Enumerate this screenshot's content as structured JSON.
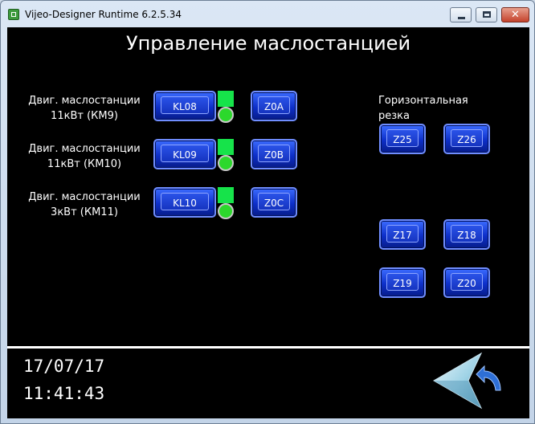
{
  "window": {
    "title": "Vijeo-Designer Runtime 6.2.5.34",
    "close_glyph": "✕"
  },
  "page": {
    "title": "Управление маслостанцией"
  },
  "motors": [
    {
      "label_line1": "Двиг. маслостанции",
      "label_line2": "11кВт (КМ9)",
      "kl_button": "KL08",
      "z_button": "Z0A",
      "status_color": "#16e34a"
    },
    {
      "label_line1": "Двиг. маслостанции",
      "label_line2": "11кВт (КМ10)",
      "kl_button": "KL09",
      "z_button": "Z0B",
      "status_color": "#16e34a"
    },
    {
      "label_line1": "Двиг. маслостанции",
      "label_line2": "3кВт (КМ11)",
      "kl_button": "KL10",
      "z_button": "Z0C",
      "status_color": "#16e34a"
    }
  ],
  "horizontal_cutting": {
    "label_line1": "Горизонтальная",
    "label_line2": "резка",
    "buttons": [
      "Z25",
      "Z26",
      "Z17",
      "Z18",
      "Z19",
      "Z20"
    ]
  },
  "footer": {
    "date": "17/07/17",
    "time": "11:41:43",
    "back_icon": "back-arrow-icon"
  },
  "colors": {
    "background": "#000000",
    "button_blue": "#1534c0",
    "indicator_green": "#16e34a"
  }
}
